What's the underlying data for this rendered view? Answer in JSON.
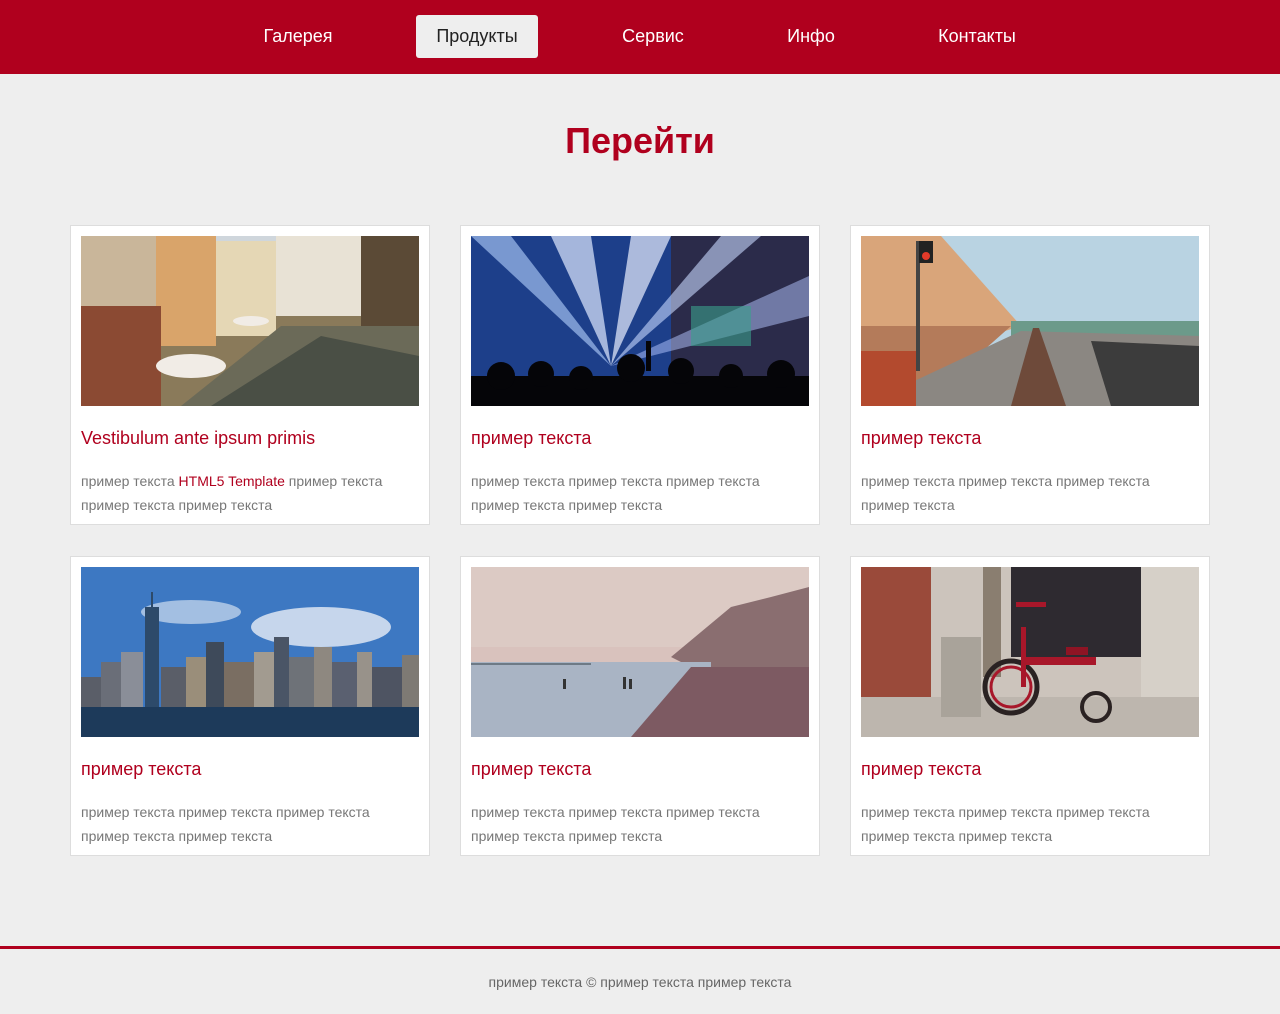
{
  "nav": {
    "items": [
      {
        "label": "Галерея"
      },
      {
        "label": "Продукты",
        "active": true
      },
      {
        "label": "Сервис"
      },
      {
        "label": "Инфо"
      },
      {
        "label": "Контакты"
      }
    ]
  },
  "colors": {
    "brand": "#b0001e",
    "background": "#eeeeee",
    "text": "#777777"
  },
  "page": {
    "title": "Перейти"
  },
  "cards": [
    {
      "image": "canal-city-photo",
      "title": "Vestibulum ante ipsum primis",
      "text_before": "пример текста ",
      "link": "HTML5 Template",
      "text_after": " пример текста пример текста пример текста"
    },
    {
      "image": "concert-lights-photo",
      "title": "пример текста",
      "text": "пример текста пример текста пример текста пример текста пример текста"
    },
    {
      "image": "railway-coast-photo",
      "title": "пример текста",
      "text": "пример текста пример текста пример текста пример текста"
    },
    {
      "image": "city-skyline-photo",
      "title": "пример текста",
      "text": "пример текста пример текста пример текста пример текста пример текста"
    },
    {
      "image": "misty-beach-photo",
      "title": "пример текста",
      "text": "пример текста пример текста пример текста пример текста пример текста"
    },
    {
      "image": "red-tricycle-photo",
      "title": "пример текста",
      "text": "пример текста пример текста пример текста пример текста пример текста"
    }
  ],
  "footer": {
    "text": "пример текста © пример текста пример текста"
  }
}
